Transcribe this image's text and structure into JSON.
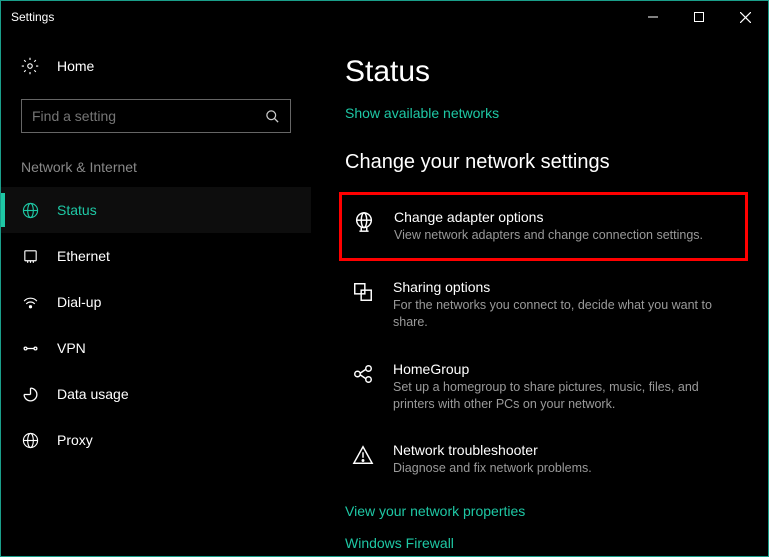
{
  "window": {
    "title": "Settings"
  },
  "sidebar": {
    "home": "Home",
    "search_placeholder": "Find a setting",
    "category": "Network & Internet",
    "items": [
      {
        "label": "Status"
      },
      {
        "label": "Ethernet"
      },
      {
        "label": "Dial-up"
      },
      {
        "label": "VPN"
      },
      {
        "label": "Data usage"
      },
      {
        "label": "Proxy"
      }
    ]
  },
  "main": {
    "title": "Status",
    "show_networks": "Show available networks",
    "change_header": "Change your network settings",
    "options": [
      {
        "title": "Change adapter options",
        "desc": "View network adapters and change connection settings."
      },
      {
        "title": "Sharing options",
        "desc": "For the networks you connect to, decide what you want to share."
      },
      {
        "title": "HomeGroup",
        "desc": "Set up a homegroup to share pictures, music, files, and printers with other PCs on your network."
      },
      {
        "title": "Network troubleshooter",
        "desc": "Diagnose and fix network problems."
      }
    ],
    "links": {
      "properties": "View your network properties",
      "firewall": "Windows Firewall"
    }
  }
}
